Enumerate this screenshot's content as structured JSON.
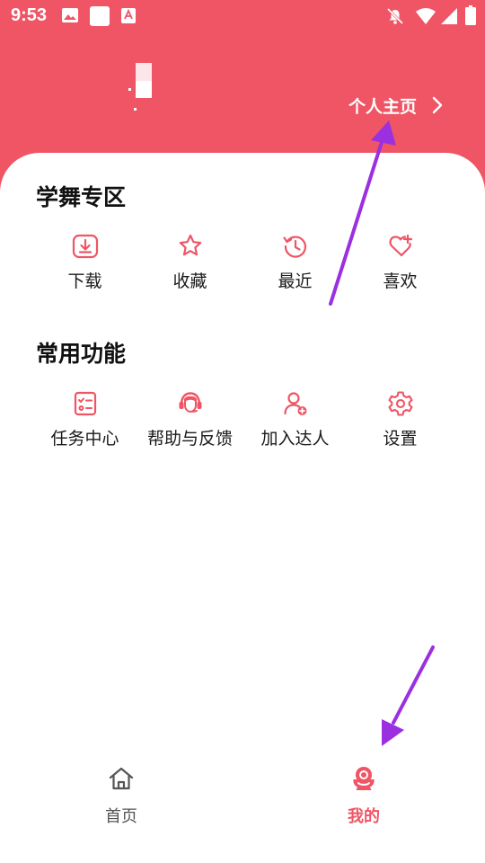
{
  "colors": {
    "accent": "#ef5565",
    "annotation": "#9b30e0"
  },
  "status_bar": {
    "time": "9:53"
  },
  "profile": {
    "link_label": "个人主页"
  },
  "sections": [
    {
      "title": "学舞专区",
      "items": [
        {
          "label": "下载",
          "icon": "download-icon"
        },
        {
          "label": "收藏",
          "icon": "star-icon"
        },
        {
          "label": "最近",
          "icon": "history-icon"
        },
        {
          "label": "喜欢",
          "icon": "heart-plus-icon"
        }
      ]
    },
    {
      "title": "常用功能",
      "items": [
        {
          "label": "任务中心",
          "icon": "task-list-icon"
        },
        {
          "label": "帮助与反馈",
          "icon": "headset-icon"
        },
        {
          "label": "加入达人",
          "icon": "user-add-icon"
        },
        {
          "label": "设置",
          "icon": "gear-icon"
        }
      ]
    }
  ],
  "bottom_nav": {
    "items": [
      {
        "label": "首页",
        "icon": "home-icon",
        "active": false
      },
      {
        "label": "我的",
        "icon": "profile-icon",
        "active": true
      }
    ]
  }
}
